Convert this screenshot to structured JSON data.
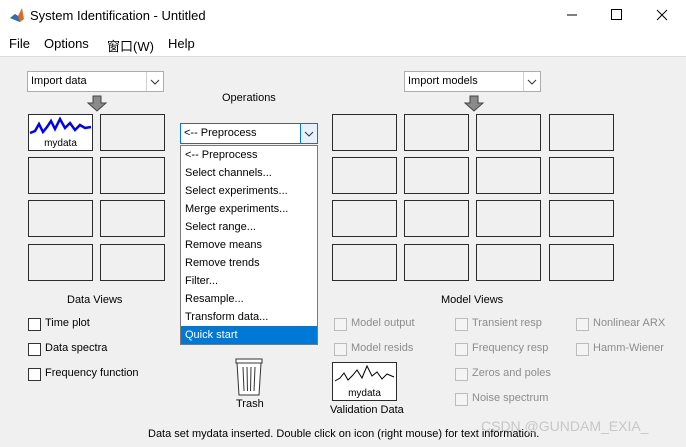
{
  "window": {
    "title": "System Identification - Untitled"
  },
  "menubar": {
    "file": "File",
    "options": "Options",
    "window": "窗口(W)",
    "help": "Help"
  },
  "data_panel": {
    "import_label": "Import data",
    "slots": [
      {
        "label": "mydata",
        "active": true
      },
      {
        "label": "",
        "active": false
      },
      {
        "label": "",
        "active": false
      },
      {
        "label": "",
        "active": false
      },
      {
        "label": "",
        "active": false
      },
      {
        "label": "",
        "active": false
      },
      {
        "label": "",
        "active": false
      },
      {
        "label": "",
        "active": false
      }
    ],
    "title": "Data Views",
    "checkboxes": [
      "Time plot",
      "Data spectra",
      "Frequency function"
    ]
  },
  "operations": {
    "title": "Operations",
    "selected": "<-- Preprocess",
    "items": [
      "<-- Preprocess",
      "Select channels...",
      "Select experiments...",
      "Merge experiments...",
      "Select range...",
      "Remove means",
      "Remove trends",
      "Filter...",
      "Resample...",
      "Transform data...",
      "Quick start"
    ],
    "highlighted": "Quick start"
  },
  "model_panel": {
    "import_label": "Import models",
    "title": "Model Views",
    "checkboxes": [
      "Model output",
      "Model resids",
      "Transient resp",
      "Frequency resp",
      "Zeros and poles",
      "Noise spectrum",
      "Nonlinear ARX",
      "Hamm-Wiener"
    ]
  },
  "trash": {
    "label": "Trash"
  },
  "validation": {
    "slot_label": "mydata",
    "label": "Validation Data"
  },
  "status": "Data set mydata inserted.  Double click on icon (right mouse) for text information.",
  "watermark": "CSDN @GUNDAM_EXIA_",
  "colors": {
    "signal": "#0000ff",
    "highlight": "#0078d7",
    "window_bg": "#f0f0f0"
  }
}
